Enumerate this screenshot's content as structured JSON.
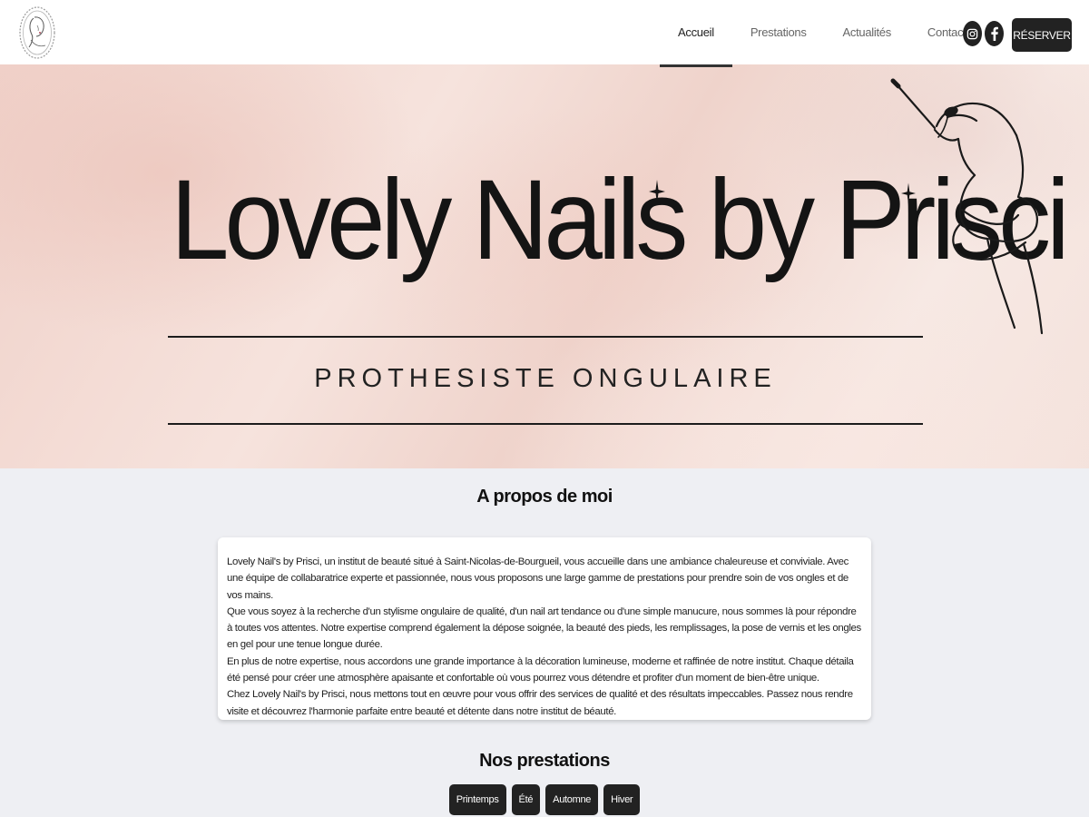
{
  "header": {
    "nav": [
      {
        "label": "Accueil",
        "active": true
      },
      {
        "label": "Prestations",
        "active": false
      },
      {
        "label": "Actualités",
        "active": false
      },
      {
        "label": "Contact",
        "active": false
      }
    ],
    "social_icons": [
      "instagram-icon",
      "facebook-icon"
    ],
    "reserve_label": "RÉSERVER"
  },
  "hero": {
    "title": "Lovely Nails by Prisci",
    "subtitle": "PROTHESISTE ONGULAIRE"
  },
  "about": {
    "title": "A propos de moi",
    "paragraphs": [
      "Lovely Nail's by Prisci, un institut de beauté situé à Saint-Nicolas-de-Bourgueil, vous accueille dans une ambiance chaleureuse et conviviale. Avec une équipe de collabaratrice experte et passionnée, nous vous proposons une large gamme de prestations pour prendre soin de vos ongles et de vos mains.",
      "Que vous soyez à la recherche d'un stylisme ongulaire de qualité, d'un nail art tendance ou d'une simple manucure, nous sommes là pour répondre à toutes vos attentes. Notre expertise comprend également la dépose soignée, la beauté des pieds, les remplissages, la pose de vernis et les ongles en gel pour une tenue longue durée.",
      "En plus de notre expertise, nous accordons une grande importance à la décoration lumineuse, moderne et raffinée de notre institut. Chaque détaila été pensé pour créer une atmosphère apaisante et confortable où vous pourrez vous détendre et profiter d'un moment de bien-être unique.",
      "Chez Lovely Nail's by Prisci, nous mettons tout en œuvre pour vous offrir des services de qualité et des résultats impeccables. Passez nous rendre visite et découvrez l'harmonie parfaite entre beauté et détente dans notre institut de béauté."
    ]
  },
  "services": {
    "title": "Nos prestations",
    "seasons": [
      "Printemps",
      "Été",
      "Automne",
      "Hiver"
    ]
  },
  "colors": {
    "background": "#eeeff3",
    "dark": "#222222",
    "hero_pink": "#f0d1c9"
  }
}
